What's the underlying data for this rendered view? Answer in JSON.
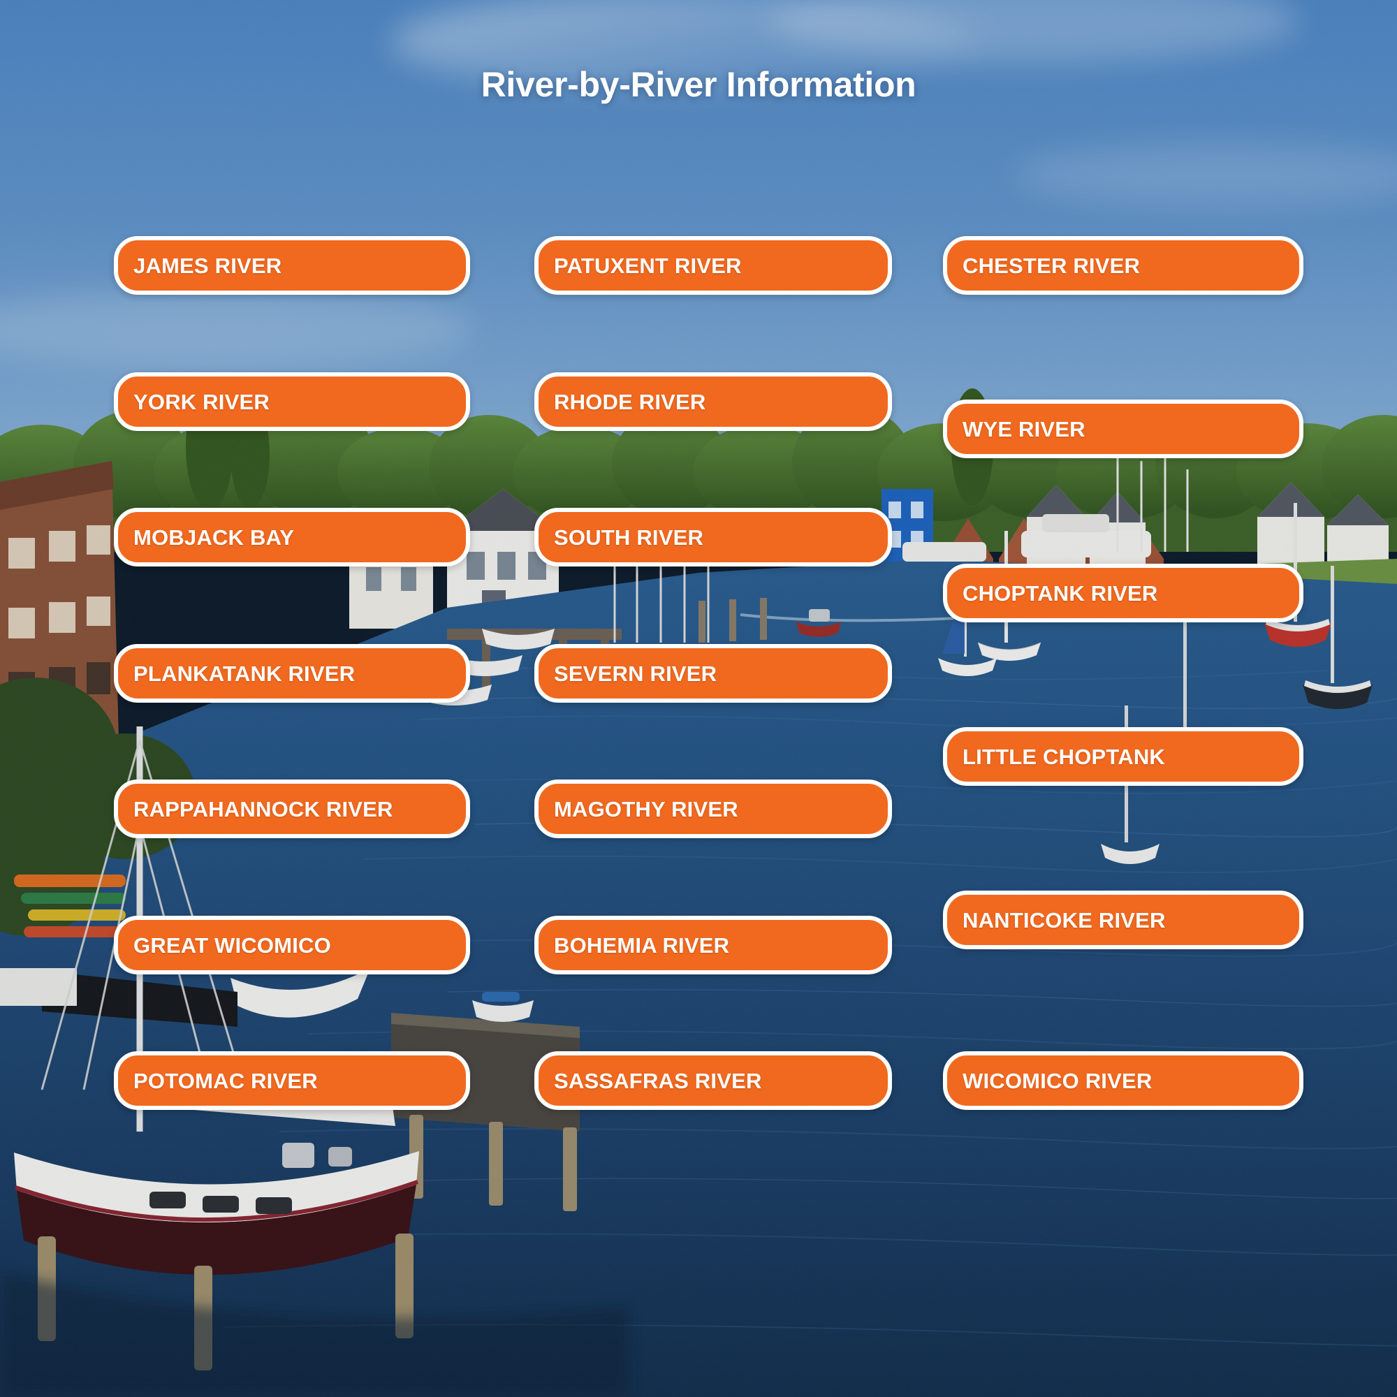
{
  "page": {
    "title": "River-by-River Information",
    "accent_color": "#F0691F",
    "border_color": "#FFFFFF",
    "text_color": "#FFFFFF",
    "sky_color": "#5E92C7",
    "water_color": "#1E4A78"
  },
  "columns": [
    {
      "id": "column-1",
      "items": [
        {
          "label": "JAMES RIVER"
        },
        {
          "label": "YORK RIVER"
        },
        {
          "label": "MOBJACK BAY"
        },
        {
          "label": "PLANKATANK RIVER"
        },
        {
          "label": "RAPPAHANNOCK RIVER"
        },
        {
          "label": "GREAT WICOMICO"
        },
        {
          "label": "POTOMAC RIVER"
        }
      ]
    },
    {
      "id": "column-2",
      "items": [
        {
          "label": "PATUXENT RIVER"
        },
        {
          "label": "RHODE RIVER"
        },
        {
          "label": "SOUTH RIVER"
        },
        {
          "label": "SEVERN RIVER"
        },
        {
          "label": "MAGOTHY RIVER"
        },
        {
          "label": "BOHEMIA RIVER"
        },
        {
          "label": "SASSAFRAS RIVER"
        }
      ]
    },
    {
      "id": "column-3",
      "items": [
        {
          "label": "CHESTER RIVER"
        },
        {
          "label": "WYE RIVER"
        },
        {
          "label": "CHOPTANK RIVER"
        },
        {
          "label": "LITTLE CHOPTANK"
        },
        {
          "label": "NANTICOKE RIVER"
        },
        {
          "label": "WICOMICO RIVER"
        }
      ]
    }
  ],
  "background": {
    "scene": "aerial-marina-harbor-photo",
    "description": "Aerial view of a harbor with sailboats, docks, waterfront houses and trees under a blue sky"
  }
}
